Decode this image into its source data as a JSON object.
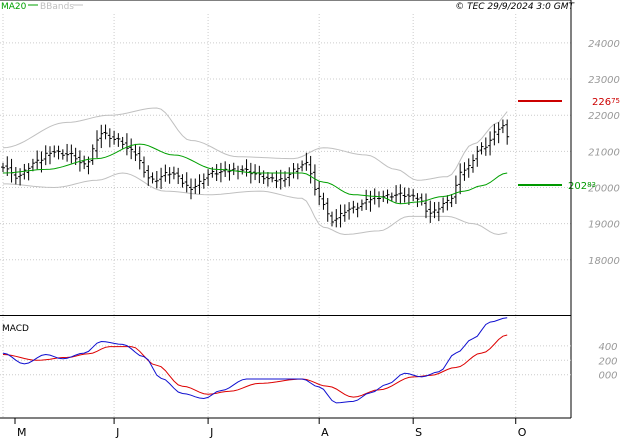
{
  "header": {
    "ma_label": "MA20",
    "bb_label": "BBands",
    "copyright": "© TEC 29/9/2024 3:0 GMT"
  },
  "colors": {
    "ma": "#00a000",
    "bbands": "#c0c0c0",
    "price": "#000000",
    "grid": "#cccccc",
    "last_price_marker": "#cc0000",
    "ma_marker": "#009900",
    "macd_line": "#1010d0",
    "signal_line": "#dd0000",
    "axis_text": "#999999"
  },
  "chart_data": [
    {
      "type": "candlestick",
      "title": "",
      "y_ticks": [
        "24000",
        "23000",
        "22000",
        "21000",
        "20000",
        "19000",
        "18000"
      ],
      "y_tick_values": [
        24000,
        23000,
        22000,
        21000,
        20000,
        19000,
        18000
      ],
      "ylim": [
        16500,
        24800
      ],
      "x_labels": [
        "M",
        "J",
        "J",
        "A",
        "S",
        "O"
      ],
      "x_label_index": [
        0,
        26,
        48,
        74,
        96,
        120
      ],
      "n_periods": 122,
      "grid": true,
      "price_anchors": [
        [
          0,
          20600
        ],
        [
          3,
          20300
        ],
        [
          8,
          20700
        ],
        [
          11,
          21000
        ],
        [
          16,
          20900
        ],
        [
          19,
          20600
        ],
        [
          23,
          21500
        ],
        [
          27,
          21300
        ],
        [
          30,
          21000
        ],
        [
          35,
          20200
        ],
        [
          39,
          20400
        ],
        [
          44,
          20000
        ],
        [
          49,
          20400
        ],
        [
          55,
          20500
        ],
        [
          64,
          20200
        ],
        [
          71,
          20650
        ],
        [
          74,
          19700
        ],
        [
          77,
          19100
        ],
        [
          81,
          19400
        ],
        [
          88,
          19750
        ],
        [
          93,
          19800
        ],
        [
          97,
          19700
        ],
        [
          100,
          19300
        ],
        [
          104,
          19600
        ],
        [
          108,
          20500
        ],
        [
          112,
          21100
        ],
        [
          117,
          21700
        ],
        [
          118,
          21350
        ]
      ],
      "ma20_anchors": [
        [
          0,
          20400
        ],
        [
          10,
          20500
        ],
        [
          22,
          20800
        ],
        [
          32,
          21200
        ],
        [
          40,
          20900
        ],
        [
          50,
          20500
        ],
        [
          60,
          20400
        ],
        [
          70,
          20400
        ],
        [
          75,
          20150
        ],
        [
          82,
          19800
        ],
        [
          88,
          19750
        ],
        [
          93,
          19550
        ],
        [
          97,
          19600
        ],
        [
          103,
          19750
        ],
        [
          108,
          19900
        ],
        [
          112,
          20050
        ],
        [
          118,
          20400
        ]
      ],
      "bb_upper_anchors": [
        [
          0,
          21100
        ],
        [
          15,
          21800
        ],
        [
          25,
          22000
        ],
        [
          36,
          22200
        ],
        [
          44,
          21300
        ],
        [
          55,
          20850
        ],
        [
          68,
          20800
        ],
        [
          75,
          21100
        ],
        [
          85,
          20900
        ],
        [
          92,
          20500
        ],
        [
          97,
          20200
        ],
        [
          104,
          20300
        ],
        [
          110,
          21200
        ],
        [
          116,
          21800
        ],
        [
          118,
          22100
        ]
      ],
      "bb_lower_anchors": [
        [
          0,
          20100
        ],
        [
          12,
          20000
        ],
        [
          22,
          20200
        ],
        [
          28,
          20400
        ],
        [
          38,
          19900
        ],
        [
          48,
          19800
        ],
        [
          60,
          19900
        ],
        [
          70,
          19700
        ],
        [
          75,
          18900
        ],
        [
          80,
          18700
        ],
        [
          88,
          18800
        ],
        [
          95,
          19200
        ],
        [
          104,
          19200
        ],
        [
          110,
          19000
        ],
        [
          116,
          18700
        ],
        [
          118,
          18750
        ]
      ],
      "last_price": {
        "int": "226",
        "dec": "75"
      },
      "ma_value": {
        "int": "202",
        "dec": "83"
      }
    },
    {
      "type": "line",
      "title": "MACD",
      "y_ticks": [
        "400",
        "200",
        "000"
      ],
      "y_tick_values": [
        400,
        200,
        0
      ],
      "ylim": [
        -600,
        800
      ],
      "series": [
        {
          "name": "MACD",
          "anchors": [
            [
              0,
              300
            ],
            [
              5,
              150
            ],
            [
              10,
              280
            ],
            [
              14,
              220
            ],
            [
              19,
              300
            ],
            [
              23,
              460
            ],
            [
              28,
              420
            ],
            [
              33,
              250
            ],
            [
              37,
              -50
            ],
            [
              42,
              -260
            ],
            [
              47,
              -330
            ],
            [
              51,
              -220
            ],
            [
              57,
              -60
            ],
            [
              63,
              -60
            ],
            [
              70,
              -60
            ],
            [
              74,
              -170
            ],
            [
              78,
              -390
            ],
            [
              82,
              -370
            ],
            [
              86,
              -250
            ],
            [
              90,
              -130
            ],
            [
              94,
              20
            ],
            [
              98,
              -30
            ],
            [
              102,
              40
            ],
            [
              106,
              300
            ],
            [
              110,
              500
            ],
            [
              114,
              730
            ],
            [
              118,
              790
            ]
          ]
        },
        {
          "name": "Signal",
          "anchors": [
            [
              0,
              280
            ],
            [
              8,
              200
            ],
            [
              15,
              240
            ],
            [
              20,
              290
            ],
            [
              25,
              390
            ],
            [
              30,
              390
            ],
            [
              36,
              130
            ],
            [
              42,
              -160
            ],
            [
              48,
              -270
            ],
            [
              53,
              -230
            ],
            [
              60,
              -120
            ],
            [
              70,
              -60
            ],
            [
              76,
              -160
            ],
            [
              82,
              -310
            ],
            [
              88,
              -210
            ],
            [
              96,
              -30
            ],
            [
              100,
              -10
            ],
            [
              106,
              100
            ],
            [
              112,
              300
            ],
            [
              118,
              550
            ]
          ]
        }
      ]
    }
  ]
}
